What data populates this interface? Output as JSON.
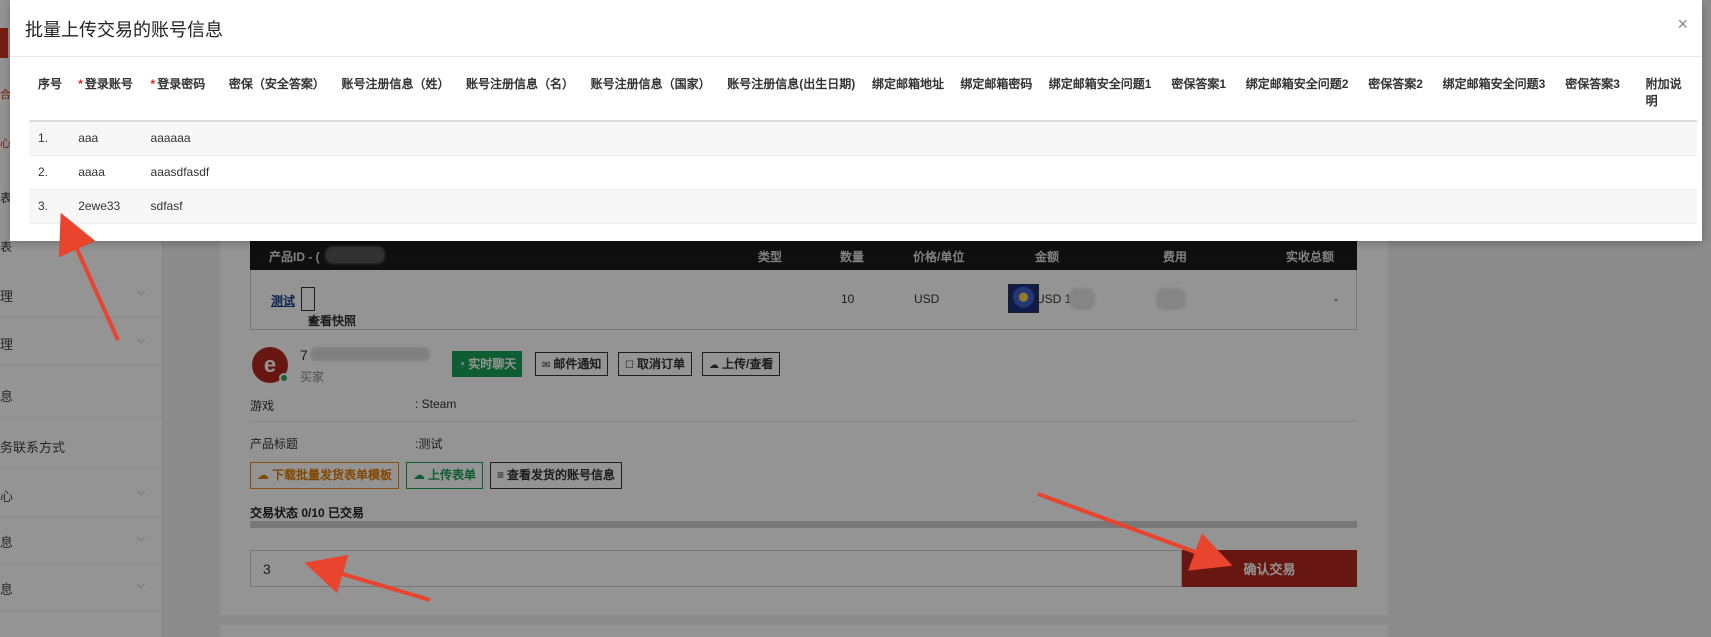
{
  "sidebar": {
    "items": [
      {
        "label": "理",
        "has_chevron": true
      },
      {
        "label": "理",
        "has_chevron": true
      },
      {
        "label": "息",
        "has_chevron": false
      },
      {
        "label": "务联系方式",
        "has_chevron": false
      },
      {
        "label": "心",
        "has_chevron": true
      },
      {
        "label": "息",
        "has_chevron": true
      },
      {
        "label": "息",
        "has_chevron": true
      }
    ],
    "edge_labels": [
      "合",
      "心",
      "表",
      "表"
    ],
    "chevron_glyph": "⌵"
  },
  "order": {
    "header": {
      "product_id": "产品ID - (",
      "type": "类型",
      "quantity": "数量",
      "unit_price": "价格/单位",
      "amount": "金额",
      "fee": "费用",
      "total": "实收总额"
    },
    "row": {
      "name": "测试",
      "snapshot_btn": "查看快照",
      "quantity": "10",
      "price": "USD",
      "amount": "USD 1",
      "total": "-"
    }
  },
  "buyer": {
    "initial": "7",
    "role": "买家",
    "avatar_letter": "e"
  },
  "actions": {
    "chat": "实时聊天",
    "email": "邮件通知",
    "cancel": "取消订单",
    "upload_view": "上传/查看"
  },
  "info": {
    "game_label": "游戏",
    "game_value": ": Steam",
    "title_label": "产品标题",
    "title_value": ":测试"
  },
  "batch": {
    "download_template": "下载批量发货表单模板",
    "upload_form": "上传表单",
    "view_accounts": "查看发货的账号信息"
  },
  "trade": {
    "status": "交易状态 0/10 已交易",
    "progress": 0,
    "quantity_value": "3",
    "confirm": "确认交易"
  },
  "modal": {
    "title": "批量上传交易的账号信息",
    "close": "×",
    "columns": [
      {
        "label": "序号",
        "required": false
      },
      {
        "label": "登录账号",
        "required": true
      },
      {
        "label": "登录密码",
        "required": true
      },
      {
        "label": "密保（安全答案）",
        "required": false
      },
      {
        "label": "账号注册信息（姓）",
        "required": false
      },
      {
        "label": "账号注册信息（名）",
        "required": false
      },
      {
        "label": "账号注册信息（国家）",
        "required": false
      },
      {
        "label": "账号注册信息(出生日期)",
        "required": false
      },
      {
        "label": "绑定邮箱地址",
        "required": false
      },
      {
        "label": "绑定邮箱密码",
        "required": false
      },
      {
        "label": "绑定邮箱安全问题1",
        "required": false
      },
      {
        "label": "密保答案1",
        "required": false
      },
      {
        "label": "绑定邮箱安全问题2",
        "required": false
      },
      {
        "label": "密保答案2",
        "required": false
      },
      {
        "label": "绑定邮箱安全问题3",
        "required": false
      },
      {
        "label": "密保答案3",
        "required": false
      },
      {
        "label": "附加说明",
        "required": false
      }
    ],
    "rows": [
      [
        "1.",
        "aaa",
        "aaaaaa",
        "",
        "",
        "",
        "",
        "",
        "",
        "",
        "",
        "",
        "",
        "",
        "",
        "",
        ""
      ],
      [
        "2.",
        "aaaa",
        "aaasdfasdf",
        "",
        "",
        "",
        "",
        "",
        "",
        "",
        "",
        "",
        "",
        "",
        "",
        "",
        ""
      ],
      [
        "3.",
        "2ewe33",
        "sdfasf",
        "",
        "",
        "",
        "",
        "",
        "",
        "",
        "",
        "",
        "",
        "",
        "",
        "",
        ""
      ]
    ]
  },
  "colors": {
    "brand_red": "#b3261e",
    "green": "#1aa057",
    "orange": "#e07a00",
    "arrow_red": "#e8442e"
  },
  "icons": {
    "snapshot": "▣",
    "chat": "◔",
    "email": "✉",
    "cancel": "☐",
    "cloud": "☁",
    "list": "≡"
  }
}
